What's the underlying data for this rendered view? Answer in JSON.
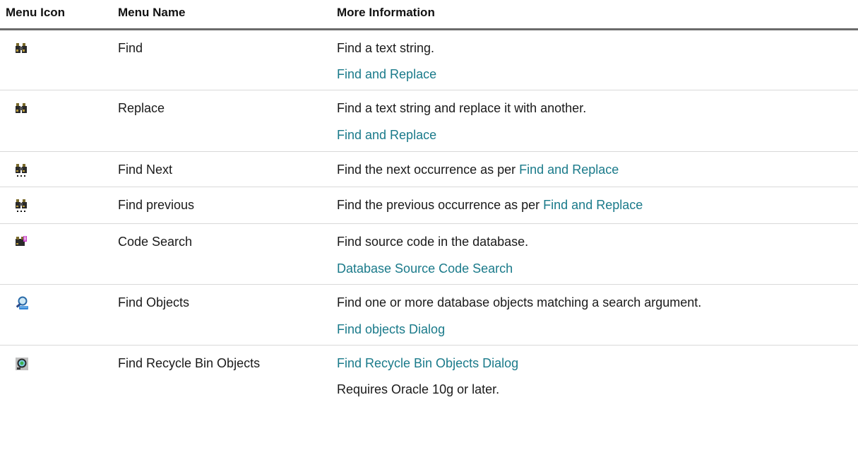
{
  "header": {
    "icon_col": "Menu Icon",
    "name_col": "Menu Name",
    "info_col": "More Information"
  },
  "rows": [
    {
      "icon": "binoculars-icon",
      "name": "Find",
      "info_text": "Find a text string.",
      "info_link": "Find and Replace"
    },
    {
      "icon": "binoculars-icon",
      "name": "Replace",
      "info_text": "Find a text string and replace it with another.",
      "info_link": "Find and Replace"
    },
    {
      "icon": "binoculars-next-icon",
      "name": "Find Next",
      "info_text": "Find the next occurrence as per ",
      "info_link": "Find and Replace"
    },
    {
      "icon": "binoculars-previous-icon",
      "name": "Find previous",
      "info_text": "Find the previous occurrence as per ",
      "info_link": "Find and Replace"
    },
    {
      "icon": "code-search-icon",
      "name": "Code Search",
      "info_text": "Find source code in the database.",
      "info_link": "Database Source Code Search"
    },
    {
      "icon": "find-objects-icon",
      "name": "Find Objects",
      "info_text": "Find one or more database objects matching a search argument.",
      "info_link": "Find objects Dialog"
    },
    {
      "icon": "recycle-bin-search-icon",
      "name": "Find Recycle Bin Objects",
      "info_link": "Find Recycle Bin Objects Dialog",
      "info_text": "Requires Oracle 10g or later."
    }
  ],
  "colors": {
    "link": "#1a7a8a",
    "header_rule": "#6b6b6b",
    "row_rule": "#d9d9d9"
  }
}
